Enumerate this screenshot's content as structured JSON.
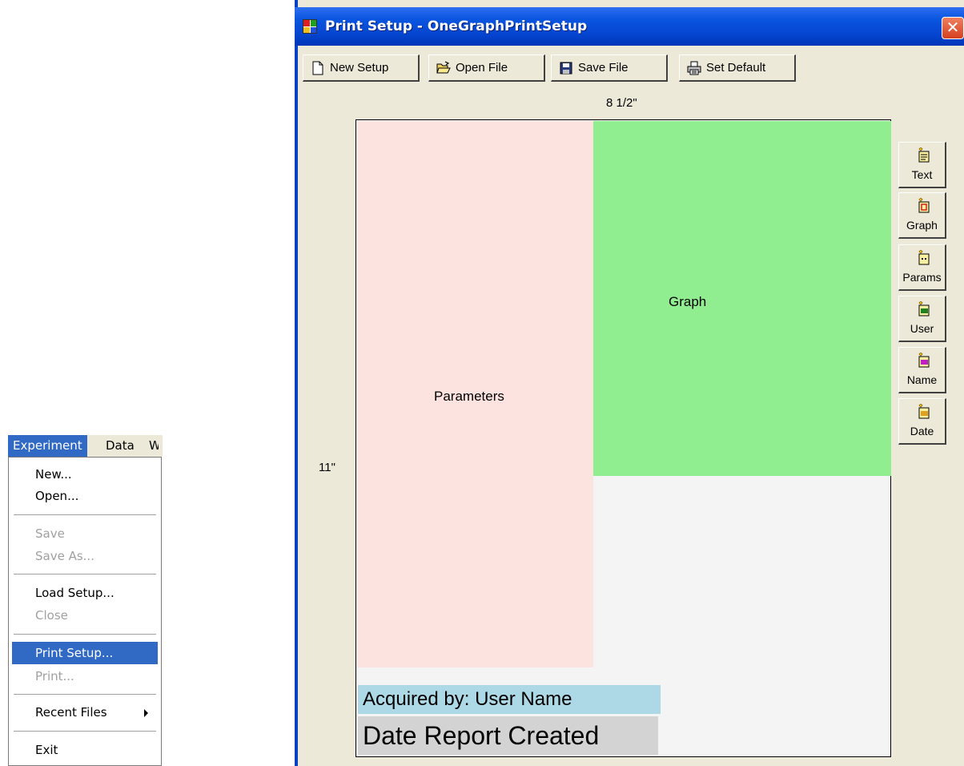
{
  "menu": {
    "bar": {
      "experiment": "Experiment",
      "data": "Data",
      "truncated": "W"
    },
    "items": [
      {
        "label": "New...",
        "state": "enabled"
      },
      {
        "label": "Open...",
        "state": "enabled"
      },
      {
        "label": "Save",
        "state": "disabled"
      },
      {
        "label": "Save As...",
        "state": "disabled"
      },
      {
        "label": "Load Setup...",
        "state": "enabled"
      },
      {
        "label": "Close",
        "state": "disabled"
      },
      {
        "label": "Print Setup...",
        "state": "selected"
      },
      {
        "label": "Print...",
        "state": "disabled"
      },
      {
        "label": "Recent Files",
        "state": "enabled",
        "has_submenu": true
      },
      {
        "label": "Exit",
        "state": "enabled"
      }
    ]
  },
  "window": {
    "title": "Print Setup - OneGraphPrintSetup",
    "close_glyph": "✕",
    "toolbar": {
      "new_setup": "New Setup",
      "open_file": "Open File",
      "save_file": "Save File",
      "set_default": "Set Default"
    },
    "page": {
      "width_label": "8 1/2\"",
      "height_label": "11\"",
      "regions": {
        "parameters": "Parameters",
        "graph": "Graph",
        "user": "Acquired by: User Name",
        "date": "Date Report Created"
      }
    },
    "side_buttons": {
      "text": "Text",
      "graph": "Graph",
      "params": "Params",
      "user": "User",
      "name": "Name",
      "date": "Date"
    }
  },
  "colors": {
    "title_bar": "#0545d0",
    "selection": "#316ac5",
    "parameters_region": "#fde3df",
    "graph_region": "#90ee90",
    "user_region": "#add8e6",
    "date_region": "#d3d3d3",
    "window_face": "#ece9d8"
  }
}
